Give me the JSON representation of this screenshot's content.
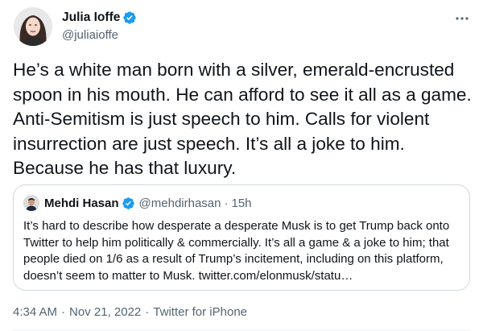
{
  "author": {
    "display_name": "Julia Ioffe",
    "handle": "@juliaioffe",
    "avatar_icon": "profile-photo",
    "verified_icon": "verified-badge-icon"
  },
  "more_icon": "more-horizontal-icon",
  "tweet_text": "He’s a white man born with a silver, emerald-encrusted spoon in his mouth. He can afford to see it all as a game. Anti-Semitism is just speech to him. Calls for violent insurrection are just speech. It’s all a joke to him. Because he has that luxury.",
  "quote": {
    "display_name": "Mehdi Hasan",
    "handle": "@mehdirhasan",
    "separator": "·",
    "time": "15h",
    "text": "It’s hard to describe how desperate a desperate Musk is to get Trump back onto Twitter to help him politically & commercially. It’s all a game & a joke to him; that people died on 1/6 as a result of Trump’s incitement, including on this platform, doesn’t seem to matter to Musk. twitter.com/elonmusk/statu…"
  },
  "meta": {
    "time": "4:34 AM",
    "separator": "·",
    "date": "Nov 21, 2022",
    "source": "Twitter for iPhone"
  },
  "colors": {
    "verified_blue": "#1d9bf0",
    "secondary_text": "#536471",
    "border": "#cfd9de"
  }
}
